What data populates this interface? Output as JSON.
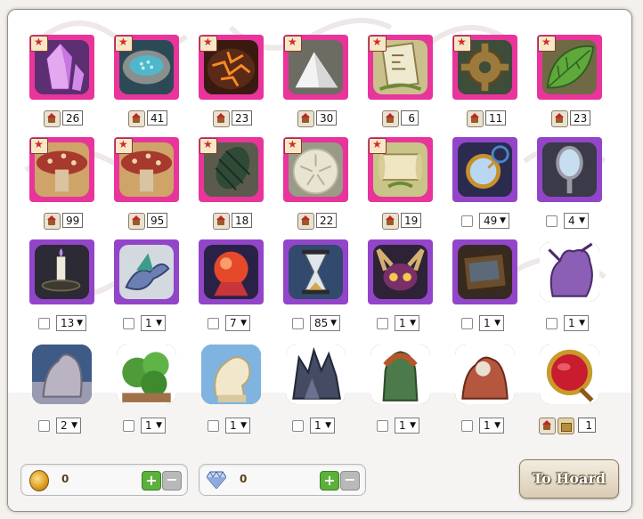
{
  "colors": {
    "pink": "#e9359b",
    "purple": "#9345c9",
    "frame": "#ffffff"
  },
  "rows": [
    [
      {
        "name": "Pink Crystal",
        "tile": "pink",
        "flag": true,
        "control": "badge",
        "count": "26",
        "art": "crystal"
      },
      {
        "name": "Geode",
        "tile": "pink",
        "flag": true,
        "control": "badge",
        "count": "41",
        "art": "geode"
      },
      {
        "name": "Magma Rock",
        "tile": "pink",
        "flag": true,
        "control": "badge",
        "count": "23",
        "art": "magma"
      },
      {
        "name": "Salt Pile",
        "tile": "pink",
        "flag": true,
        "control": "badge",
        "count": "30",
        "art": "salt"
      },
      {
        "name": "Rune Tablet",
        "tile": "pink",
        "flag": true,
        "control": "badge",
        "count": "6",
        "art": "tablet"
      },
      {
        "name": "Bronze Gear",
        "tile": "pink",
        "flag": true,
        "control": "badge",
        "count": "11",
        "art": "gear"
      },
      {
        "name": "Green Leaf",
        "tile": "pink",
        "flag": true,
        "control": "badge",
        "count": "23",
        "art": "leaf"
      }
    ],
    [
      {
        "name": "Red Mushroom",
        "tile": "pink",
        "flag": true,
        "control": "badge",
        "count": "99",
        "art": "mushroom"
      },
      {
        "name": "Red Mushroom",
        "tile": "pink",
        "flag": true,
        "control": "badge",
        "count": "95",
        "art": "mushroom"
      },
      {
        "name": "Pine Cone",
        "tile": "pink",
        "flag": true,
        "control": "badge",
        "count": "18",
        "art": "pinecone"
      },
      {
        "name": "Sand Dollar",
        "tile": "pink",
        "flag": true,
        "control": "badge",
        "count": "22",
        "art": "sanddollar"
      },
      {
        "name": "Old Scroll",
        "tile": "pink",
        "flag": true,
        "control": "badge",
        "count": "19",
        "art": "scroll"
      },
      {
        "name": "Brass Monocle",
        "tile": "purple",
        "flag": false,
        "control": "select",
        "count": "49",
        "art": "monocle"
      },
      {
        "name": "Hand Mirror",
        "tile": "purple",
        "flag": false,
        "control": "select",
        "count": "4",
        "art": "mirror"
      }
    ],
    [
      {
        "name": "Candle Holder",
        "tile": "purple",
        "flag": false,
        "control": "select",
        "count": "13",
        "art": "candle"
      },
      {
        "name": "Dragon Familiar",
        "tile": "purple",
        "flag": false,
        "control": "select",
        "count": "1",
        "art": "dragon"
      },
      {
        "name": "Crystal Ball",
        "tile": "purple",
        "flag": false,
        "control": "select",
        "count": "7",
        "art": "orb"
      },
      {
        "name": "Hourglass",
        "tile": "purple",
        "flag": false,
        "control": "select",
        "count": "85",
        "art": "hourglass"
      },
      {
        "name": "Horned Mask",
        "tile": "purple",
        "flag": false,
        "control": "select",
        "count": "1",
        "art": "mask"
      },
      {
        "name": "Old Tome",
        "tile": "purple",
        "flag": false,
        "control": "select",
        "count": "1",
        "art": "tome"
      },
      {
        "name": "Purple Dragon Statue",
        "tile": "plain",
        "flag": false,
        "control": "select",
        "count": "1",
        "art": "purpledragon"
      }
    ],
    [
      {
        "name": "Stone Dragon Statue",
        "tile": "plain",
        "flag": false,
        "control": "select",
        "count": "2",
        "art": "stonedragon"
      },
      {
        "name": "Topiary Dragon",
        "tile": "plain",
        "flag": false,
        "control": "select",
        "count": "1",
        "art": "topiary"
      },
      {
        "name": "Ivory Statue",
        "tile": "plain",
        "flag": false,
        "control": "select",
        "count": "1",
        "art": "ivory"
      },
      {
        "name": "Dark Shard Statue",
        "tile": "plain",
        "flag": false,
        "control": "select",
        "count": "1",
        "art": "darkshard"
      },
      {
        "name": "Forest Guardian Statue",
        "tile": "plain",
        "flag": false,
        "control": "select",
        "count": "1",
        "art": "guardian"
      },
      {
        "name": "Coral Dragon Statue",
        "tile": "plain",
        "flag": false,
        "control": "select",
        "count": "1",
        "art": "coral"
      },
      {
        "name": "Ruby Mirror",
        "tile": "plain",
        "flag": false,
        "control": "double",
        "count": "1",
        "art": "rubymirror"
      }
    ]
  ],
  "treasure": {
    "amount": "0",
    "plus": "+",
    "minus": "−"
  },
  "gems": {
    "amount": "0",
    "plus": "+",
    "minus": "−"
  },
  "hoard_button": "To Hoard"
}
